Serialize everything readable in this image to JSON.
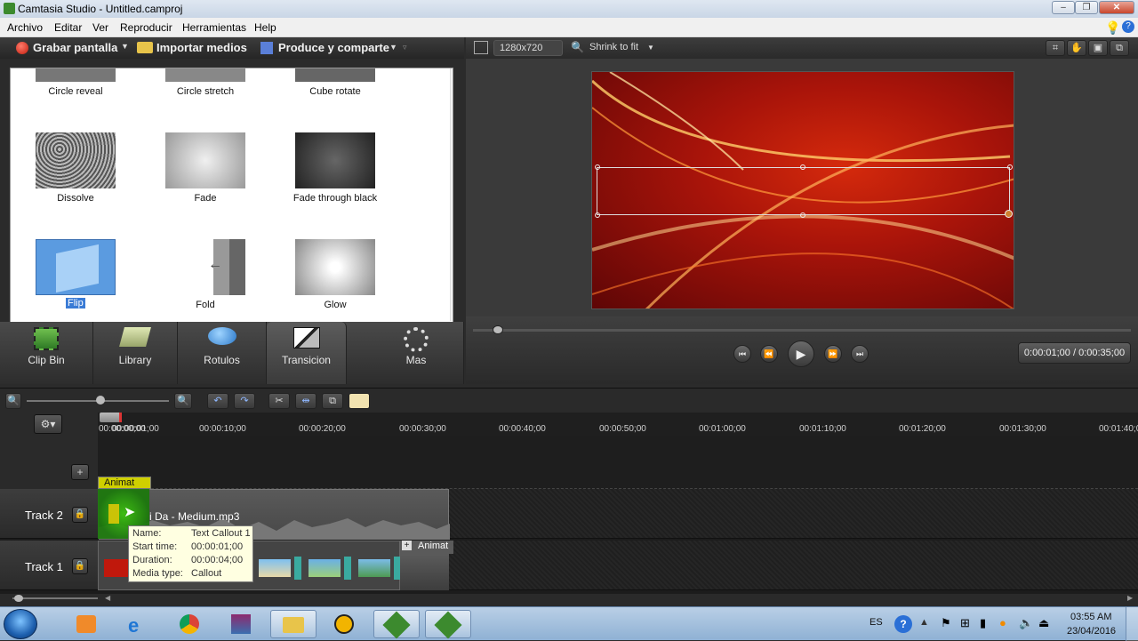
{
  "window": {
    "title": "Camtasia Studio - Untitled.camproj"
  },
  "menu": [
    "Archivo",
    "Editar",
    "Ver",
    "Reproducir",
    "Herramientas",
    "Help"
  ],
  "toolbar": {
    "record": "Grabar pantalla",
    "import": "Importar medios",
    "produce": "Produce y comparte"
  },
  "transitions": {
    "row0": [
      "Circle reveal",
      "Circle stretch",
      "Cube rotate"
    ],
    "row1": [
      "Dissolve",
      "Fade",
      "Fade through black"
    ],
    "row2": [
      "Flip",
      "Fold",
      "Glow"
    ]
  },
  "tabs": [
    "Clip Bin",
    "Library",
    "Rotulos",
    "Transicion",
    "Mas"
  ],
  "preview": {
    "size": "1280x720",
    "zoom": "Shrink to fit",
    "time": "0:00:01;00 / 0:00:35;00"
  },
  "timeline": {
    "ruler": [
      "00:00:00;00",
      "00:00:01;00",
      "00:00:10;00",
      "00:00:20;00",
      "00:00:30;00",
      "00:00:40;00",
      "00:00:50;00",
      "00:01:00;00",
      "00:01:10;00",
      "00:01:20;00",
      "00:01:30;00",
      "00:01:40;00"
    ],
    "animation_label": "Animat",
    "animation_label_2": "Animat",
    "tracks": [
      "Track 2",
      "Track 1"
    ],
    "audio_clip": "i Da - Medium.mp3"
  },
  "tooltip": {
    "name_key": "Name:",
    "name_val": "Text Callout 1",
    "start_key": "Start time:",
    "start_val": "00:00:01;00",
    "dur_key": "Duration:",
    "dur_val": "00:00:04;00",
    "type_key": "Media type:",
    "type_val": "Callout"
  },
  "taskbar": {
    "lang": "ES",
    "time": "03:55 AM",
    "date": "23/04/2016"
  },
  "colors": {
    "accent": "#4a90d9",
    "canvas_red": "#c21c0c",
    "animation_yellow": "#e5e100"
  }
}
